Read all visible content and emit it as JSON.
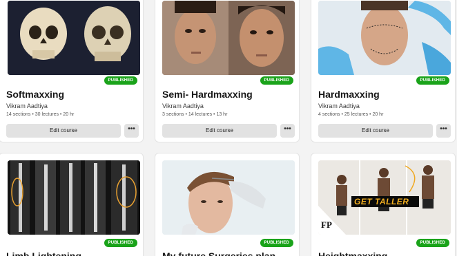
{
  "colors": {
    "published": "#1aa31a",
    "button_bg": "#e2e2e2"
  },
  "courses": [
    {
      "title": "Softmaxxing",
      "author": "Vikram Aadtiya",
      "meta": "14 sections • 30 lectures • 20 hr",
      "status": "PUBLISHED",
      "edit_label": "Edit course",
      "more_label": "•••"
    },
    {
      "title": "Semi- Hardmaxxing",
      "author": "Vikram Aadtiya",
      "meta": "3 sections • 14 lectures • 13 hr",
      "status": "PUBLISHED",
      "edit_label": "Edit course",
      "more_label": "•••"
    },
    {
      "title": "Hardmaxxing",
      "author": "Vikram Aadtiya",
      "meta": "4 sections • 25 lectures • 20 hr",
      "status": "PUBLISHED",
      "edit_label": "Edit course",
      "more_label": "•••"
    },
    {
      "title": "Limb Lightening",
      "status": "PUBLISHED"
    },
    {
      "title": "My future Surgeries plan",
      "status": "PUBLISHED"
    },
    {
      "title": "Heightmaxxing",
      "status": "PUBLISHED",
      "thumb_text": "GET TALLER",
      "thumb_logo": "FP"
    }
  ]
}
